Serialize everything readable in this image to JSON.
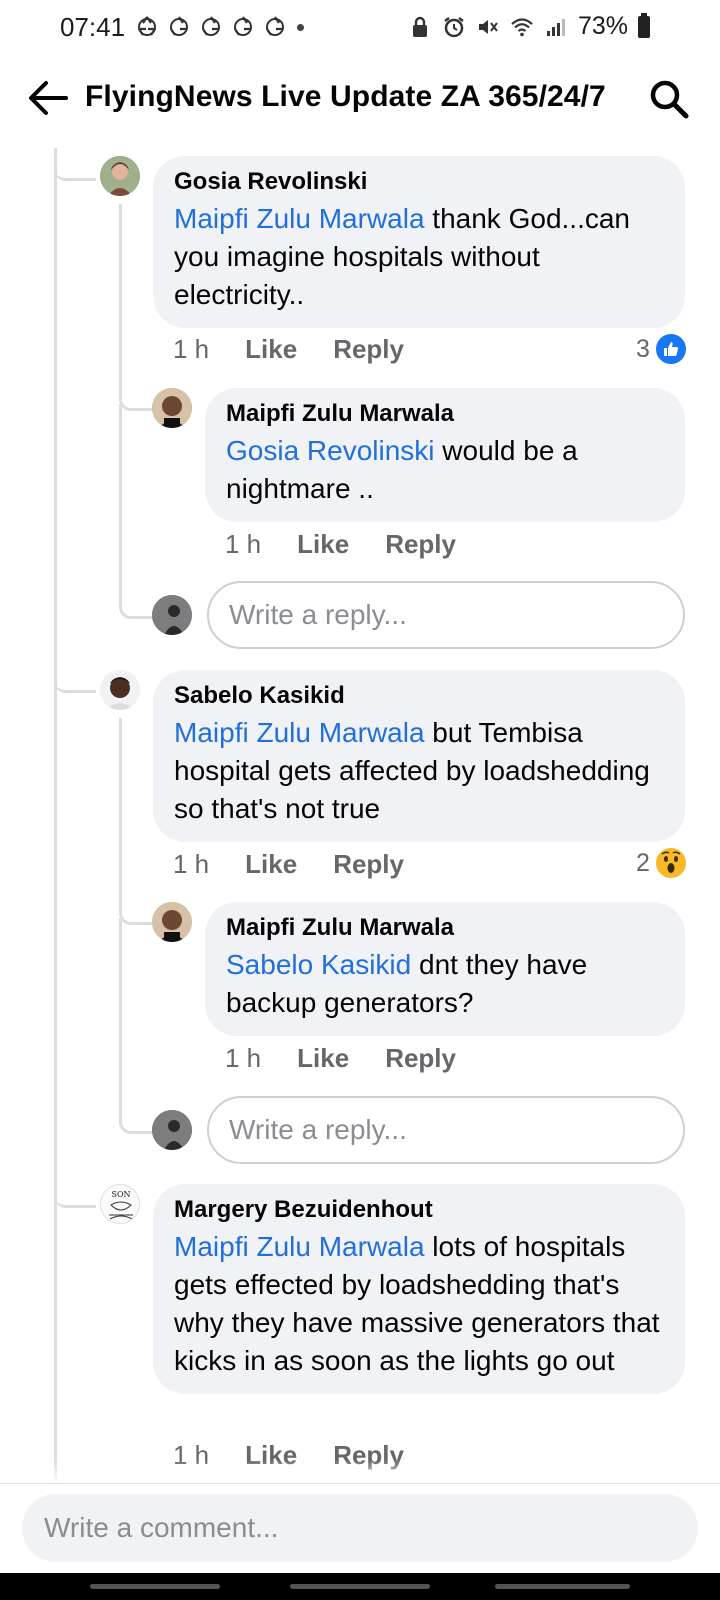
{
  "status_bar": {
    "time": "07:41",
    "battery": "73%"
  },
  "header": {
    "title": "FlyingNews Live Update ZA 365/24/7"
  },
  "comments": [
    {
      "author": "Gosia Revolinski",
      "mention": "Maipfi Zulu Marwala",
      "text": " thank God...can you imagine hospitals without electricity..",
      "time": "1 h",
      "like": "Like",
      "reply": "Reply",
      "reaction_count": "3",
      "reaction_icon": "like-icon",
      "replies": [
        {
          "author": "Maipfi Zulu Marwala",
          "mention": "Gosia Revolinski",
          "text": " would be a nightmare ..",
          "time": "1 h",
          "like": "Like",
          "reply": "Reply"
        }
      ],
      "reply_placeholder": "Write a reply..."
    },
    {
      "author": "Sabelo Kasikid",
      "mention": "Maipfi Zulu Marwala",
      "text": " but Tembisa hospital gets affected by loadshedding so that's not true",
      "time": "1 h",
      "like": "Like",
      "reply": "Reply",
      "reaction_count": "2",
      "reaction_icon": "wow-icon",
      "replies": [
        {
          "author": "Maipfi Zulu Marwala",
          "mention": "Sabelo Kasikid",
          "text": " dnt they have backup generators?",
          "time": "1 h",
          "like": "Like",
          "reply": "Reply"
        }
      ],
      "reply_placeholder": "Write a reply..."
    },
    {
      "author": "Margery Bezuidenhout",
      "mention": "Maipfi Zulu Marwala",
      "text": " lots of hospitals gets effected by loadshedding that's why they have massive generators that kicks in as soon as the lights go out",
      "time": "1 h",
      "like": "Like",
      "reply": "Reply",
      "avatar_text": "SON"
    }
  ],
  "comment_input": {
    "placeholder": "Write a comment..."
  },
  "colors": {
    "mention": "#216fdb",
    "bubble": "#f0f2f5",
    "like_blue": "#1877f2",
    "wow_yellow": "#f7b928"
  }
}
